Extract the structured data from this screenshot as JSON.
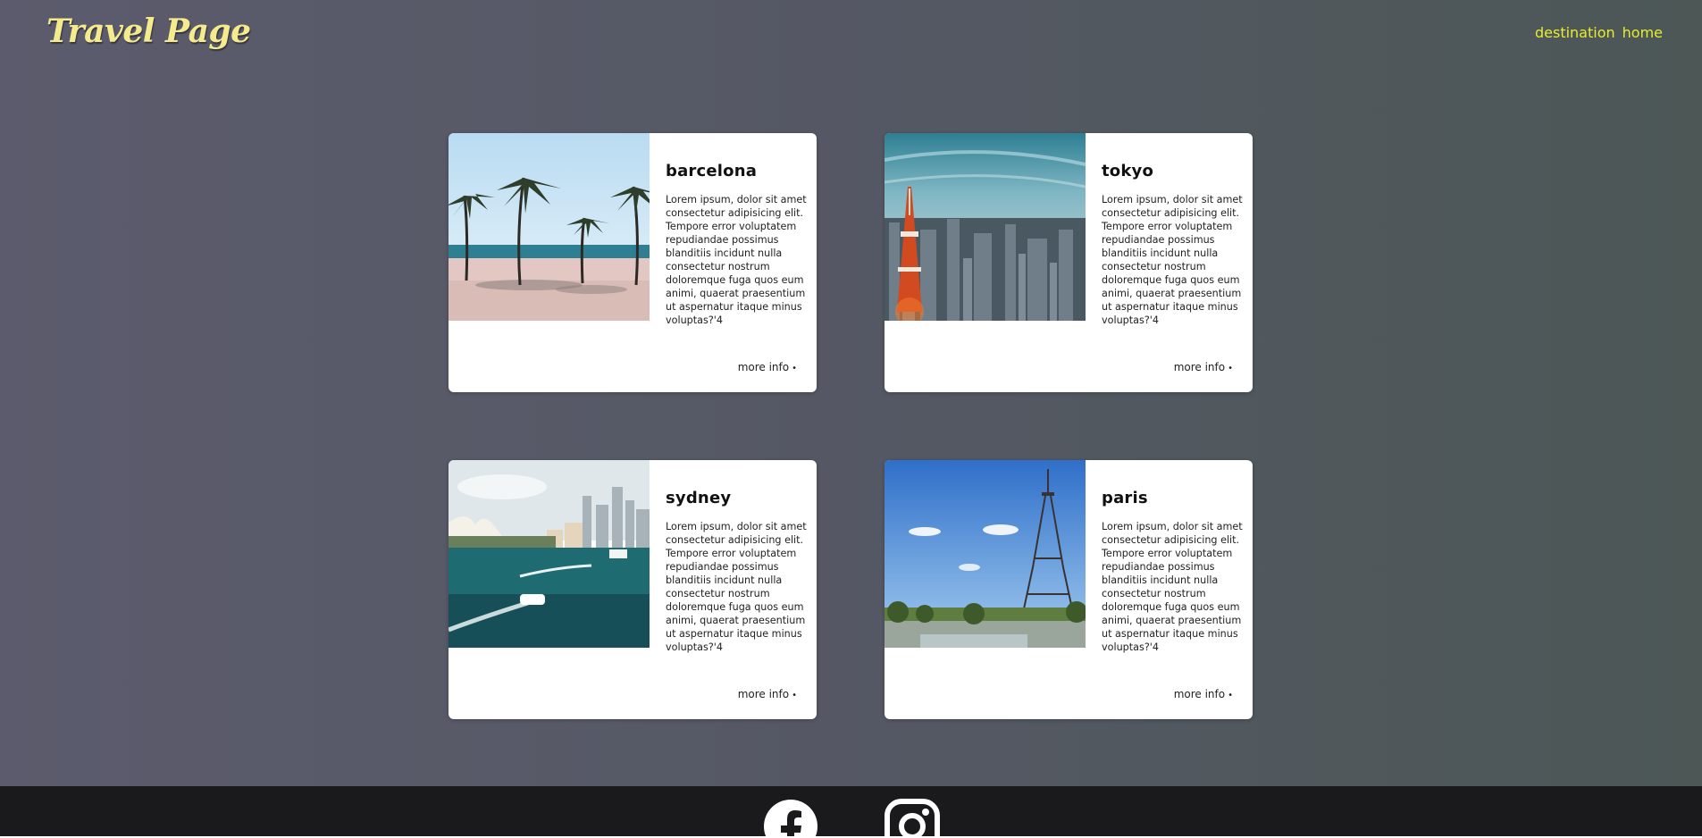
{
  "header": {
    "logo": "Travel Page",
    "nav": [
      {
        "label": "destination"
      },
      {
        "label": "home"
      }
    ]
  },
  "cards": [
    {
      "title": "barcelona",
      "text": "Lorem ipsum, dolor sit amet consectetur adipisicing elit. Tempore error voluptatem repudiandae possimus blanditiis incidunt nulla consectetur nostrum doloremque fuga quos eum animi, quaerat praesentium ut aspernatur itaque minus voluptas?'4",
      "more": "more info",
      "bullet": "•"
    },
    {
      "title": "tokyo",
      "text": "Lorem ipsum, dolor sit amet consectetur adipisicing elit. Tempore error voluptatem repudiandae possimus blanditiis incidunt nulla consectetur nostrum doloremque fuga quos eum animi, quaerat praesentium ut aspernatur itaque minus voluptas?'4",
      "more": "more info",
      "bullet": "•"
    },
    {
      "title": "sydney",
      "text": "Lorem ipsum, dolor sit amet consectetur adipisicing elit. Tempore error voluptatem repudiandae possimus blanditiis incidunt nulla consectetur nostrum doloremque fuga quos eum animi, quaerat praesentium ut aspernatur itaque minus voluptas?'4",
      "more": "more info",
      "bullet": "•"
    },
    {
      "title": "paris",
      "text": "Lorem ipsum, dolor sit amet consectetur adipisicing elit. Tempore error voluptatem repudiandae possimus blanditiis incidunt nulla consectetur nostrum doloremque fuga quos eum animi, quaerat praesentium ut aspernatur itaque minus voluptas?'4",
      "more": "more info",
      "bullet": "•"
    }
  ],
  "footer": {
    "icons": [
      "facebook-icon",
      "instagram-icon"
    ]
  },
  "colors": {
    "logo": "#f5eb8c",
    "nav": "#e8ec2e",
    "background": "#545863",
    "footer": "#1a191b"
  }
}
